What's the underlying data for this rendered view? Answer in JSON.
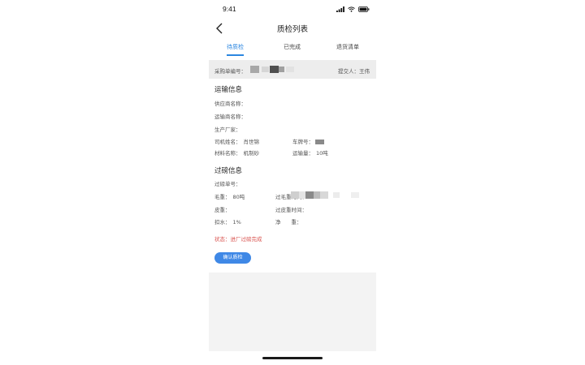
{
  "status_bar": {
    "time": "9:41"
  },
  "nav": {
    "title": "质检列表"
  },
  "tabs": [
    {
      "label": "待质检",
      "active": true
    },
    {
      "label": "已完成",
      "active": false
    },
    {
      "label": "退货清单",
      "active": false
    }
  ],
  "order": {
    "label": "采购单编号：",
    "submitter_label": "提交人：",
    "submitter_name": "王伟"
  },
  "transport": {
    "title": "运输信息",
    "supplier_label": "供应商名称：",
    "carrier_label": "运输商名称：",
    "manufacturer_label": "生产厂家：",
    "driver_label": "司机姓名：",
    "driver_value": "肖世锦",
    "plate_label": "车牌号：",
    "material_label": "材料名称：",
    "material_value": "机制砂",
    "volume_label": "运输量：",
    "volume_value": "10吨"
  },
  "weighing": {
    "title": "过磅信息",
    "ticket_label": "过磅单号：",
    "gross_label": "毛重：",
    "gross_value": "80吨",
    "gross_time_label": "过毛重时间：",
    "tare_label": "皮重：",
    "tare_time_label": "过皮重时间：",
    "deduct_label": "扣水：",
    "deduct_value": "1%",
    "net_label": "净　　重："
  },
  "status": {
    "text": "状态：进厂过磅完成"
  },
  "actions": {
    "confirm_label": "确认质检"
  },
  "colors": {
    "accent": "#2b86e0",
    "button": "#3f88e6",
    "status": "#d9534f",
    "order_bar": "#ededed"
  }
}
